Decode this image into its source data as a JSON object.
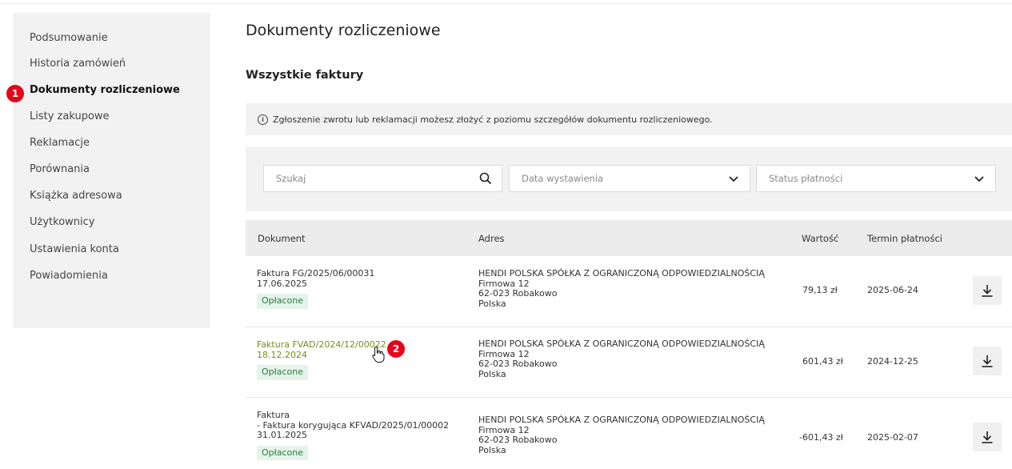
{
  "sidebar": {
    "items": [
      {
        "label": "Podsumowanie"
      },
      {
        "label": "Historia zamówień"
      },
      {
        "label": "Dokumenty rozliczeniowe",
        "active": true
      },
      {
        "label": "Listy zakupowe"
      },
      {
        "label": "Reklamacje"
      },
      {
        "label": "Porównania"
      },
      {
        "label": "Książka adresowa"
      },
      {
        "label": "Użytkownicy"
      },
      {
        "label": "Ustawienia konta"
      },
      {
        "label": "Powiadomienia"
      }
    ]
  },
  "steps": {
    "one": "1",
    "two": "2"
  },
  "main": {
    "title": "Dokumenty rozliczeniowe",
    "subtitle": "Wszystkie faktury",
    "info_icon": "info-icon",
    "info_text": "Zgłoszenie zwrotu lub reklamacji możesz złożyć z poziomu szczegółów dokumentu rozliczeniowego."
  },
  "filters": {
    "search_placeholder": "Szukaj",
    "search_icon": "search-icon",
    "date_placeholder": "Data wystawienia",
    "status_placeholder": "Status płatności",
    "chevron_icon": "chevron-down-icon"
  },
  "table": {
    "headers": {
      "document": "Dokument",
      "address": "Adres",
      "value": "Wartość",
      "due": "Termin płatności"
    },
    "rows": [
      {
        "doc_line1": "Faktura FG/2025/06/00031",
        "doc_line2": "17.06.2025",
        "doc_line3": "",
        "status": "Opłacone",
        "addr_company": "HENDI POLSKA SPÓŁKA Z OGRANICZONĄ ODPOWIEDZIALNOŚCIĄ",
        "addr_street": "Firmowa 12",
        "addr_city": "62-023 Robakowo",
        "addr_country": "Polska",
        "value": "79,13 zł",
        "due": "2025-06-24"
      },
      {
        "doc_line1": "Faktura FVAD/2024/12/00022",
        "doc_line2": "18.12.2024",
        "doc_line3": "",
        "status": "Opłacone",
        "addr_company": "HENDI POLSKA SPÓŁKA Z OGRANICZONĄ ODPOWIEDZIALNOŚCIĄ",
        "addr_street": "Firmowa 12",
        "addr_city": "62-023 Robakowo",
        "addr_country": "Polska",
        "value": "601,43 zł",
        "due": "2024-12-25"
      },
      {
        "doc_line1": "Faktura",
        "doc_line2": "- Faktura korygująca KFVAD/2025/01/00002",
        "doc_line3": "31.01.2025",
        "status": "Opłacone",
        "addr_company": "HENDI POLSKA SPÓŁKA Z OGRANICZONĄ ODPOWIEDZIALNOŚCIĄ",
        "addr_street": "Firmowa 12",
        "addr_city": "62-023 Robakowo",
        "addr_country": "Polska",
        "value": "-601,43 zł",
        "due": "2025-02-07"
      }
    ]
  },
  "colors": {
    "accent_link": "#7a8a1e",
    "step_badge": "#e4061b",
    "paid_badge_bg": "#e4f4ea",
    "paid_badge_text": "#2d7a3e"
  }
}
